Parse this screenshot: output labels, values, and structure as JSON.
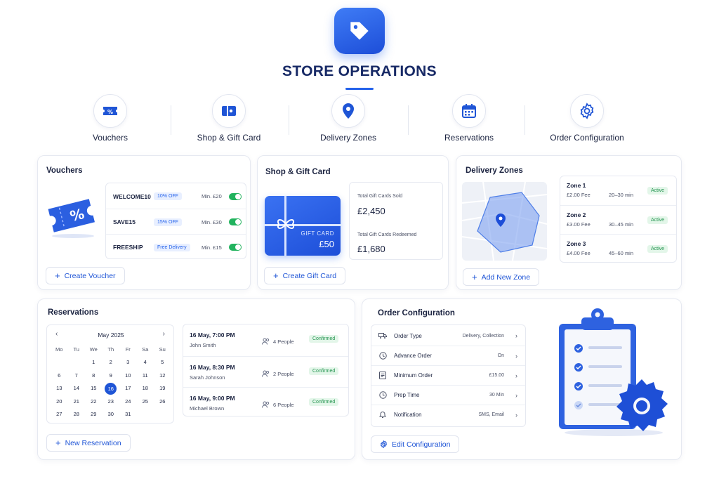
{
  "header": {
    "title": "STORE OPERATIONS",
    "app_icon": "tag-icon"
  },
  "nav": [
    {
      "label": "Vouchers",
      "icon": "voucher-icon"
    },
    {
      "label": "Shop & Gift Card",
      "icon": "gift-card-icon"
    },
    {
      "label": "Delivery Zones",
      "icon": "map-pin-icon"
    },
    {
      "label": "Reservations",
      "icon": "calendar-icon"
    },
    {
      "label": "Order Configuration",
      "icon": "gear-icon"
    }
  ],
  "vouchers": {
    "title": "Vouchers",
    "items": [
      {
        "code": "WELCOME10",
        "discount": "10% OFF",
        "min": "Min. £20",
        "enabled": true
      },
      {
        "code": "SAVE15",
        "discount": "15% OFF",
        "min": "Min. £30",
        "enabled": true
      },
      {
        "code": "FREESHIP",
        "discount": "Free Delivery",
        "min": "Min. £15",
        "enabled": true
      }
    ],
    "create_label": "Create Voucher"
  },
  "gift": {
    "title": "Shop & Gift Card",
    "card_label": "GIFT CARD",
    "card_value": "£50",
    "sold_label": "Total Gift Cards Sold",
    "sold_value": "£2,450",
    "redeemed_label": "Total Gift Cards Redeemed",
    "redeemed_value": "£1,680",
    "create_label": "Create Gift Card"
  },
  "delivery": {
    "title": "Delivery Zones",
    "zones": [
      {
        "name": "Zone 1",
        "fee": "£2.00 Fee",
        "time": "20–30 min",
        "status": "Active"
      },
      {
        "name": "Zone 2",
        "fee": "£3.00 Fee",
        "time": "30–45 min",
        "status": "Active"
      },
      {
        "name": "Zone 3",
        "fee": "£4.00 Fee",
        "time": "45–60 min",
        "status": "Active"
      }
    ],
    "add_label": "Add New Zone"
  },
  "reservations": {
    "title": "Reservations",
    "calendar": {
      "month": "May 2025",
      "weekdays": [
        "Mo",
        "Tu",
        "We",
        "Th",
        "Fr",
        "Sa",
        "Su"
      ],
      "days": [
        "",
        "",
        "",
        "",
        "",
        "",
        "",
        "",
        "",
        "1",
        "2",
        "3",
        "4",
        "5",
        "6",
        "7",
        "8",
        "9",
        "10",
        "11",
        "12",
        "13",
        "14",
        "15",
        "16",
        "17",
        "18",
        "19",
        "20",
        "21",
        "22",
        "23",
        "24",
        "25",
        "26",
        "27",
        "28",
        "29",
        "30",
        "31"
      ],
      "selected": "16"
    },
    "items": [
      {
        "time": "16 May, 7:00 PM",
        "name": "John Smith",
        "people": "4 People",
        "status": "Confirmed"
      },
      {
        "time": "16 May, 8:30 PM",
        "name": "Sarah Johnson",
        "people": "2 People",
        "status": "Confirmed"
      },
      {
        "time": "16 May, 9:00 PM",
        "name": "Michael Brown",
        "people": "6 People",
        "status": "Confirmed"
      }
    ],
    "new_label": "New Reservation"
  },
  "order_config": {
    "title": "Order Configuration",
    "rows": [
      {
        "label": "Order Type",
        "value": "Delivery, Collection",
        "icon": "truck-icon"
      },
      {
        "label": "Advance Order",
        "value": "On",
        "icon": "clock-icon"
      },
      {
        "label": "Minimum Order",
        "value": "£15.00",
        "icon": "receipt-icon"
      },
      {
        "label": "Prep Time",
        "value": "30 Min",
        "icon": "timer-icon"
      },
      {
        "label": "Notification",
        "value": "SMS, Email",
        "icon": "bell-icon"
      }
    ],
    "edit_label": "Edit Configuration"
  }
}
